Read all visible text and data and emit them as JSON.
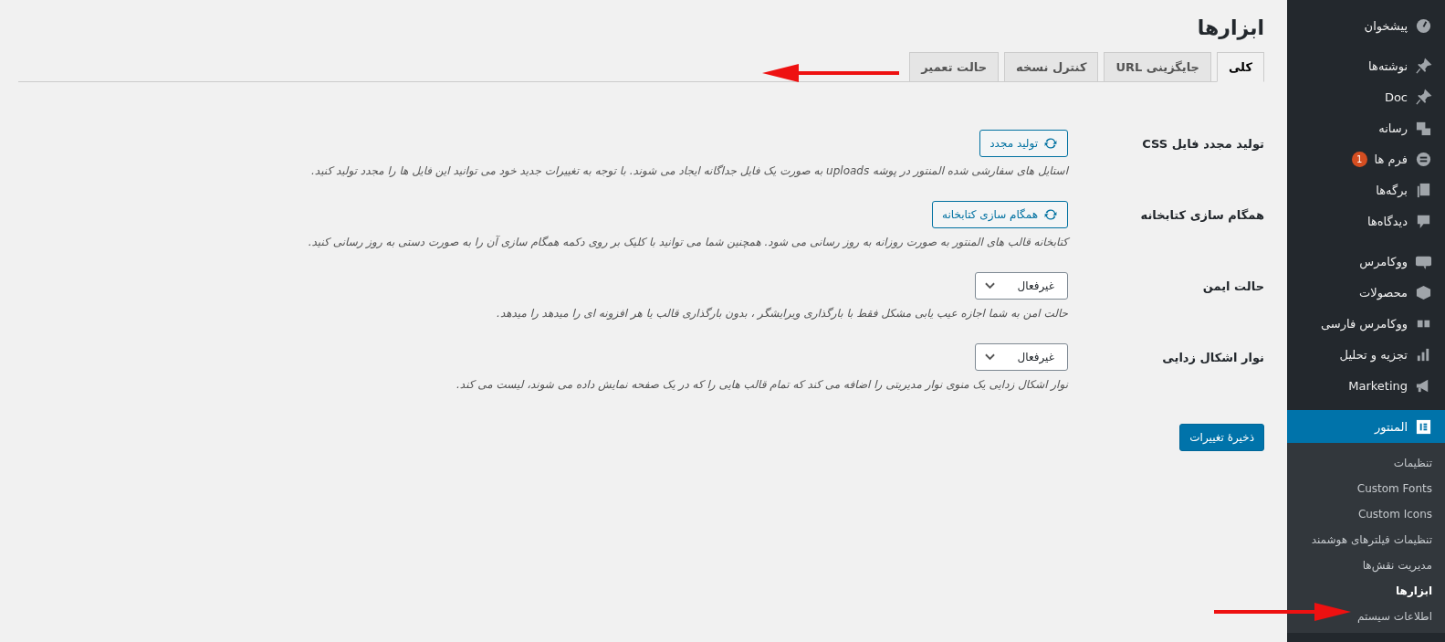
{
  "page_title": "ابزارها",
  "tabs": [
    {
      "label": "کلی",
      "selected": true
    },
    {
      "label": "جایگزینی URL",
      "selected": false
    },
    {
      "label": "کنترل نسخه",
      "selected": false
    },
    {
      "label": "حالت تعمیر",
      "selected": false
    }
  ],
  "settings": [
    {
      "kind": "button",
      "label": "تولید مجدد فایل CSS",
      "control": "تولید مجدد",
      "description": "استایل های سفارشی شده المنتور در پوشه uploads به صورت یک فایل جداگانه ایجاد می شوند. با توجه به تغییرات جدید خود می توانید این فایل ها را مجدد تولید کنید."
    },
    {
      "kind": "button",
      "label": "همگام سازی کتابخانه",
      "control": "همگام سازی کتابخانه",
      "description": "کتابخانه قالب های المنتور به صورت روزانه به روز رسانی می شود. همچنین شما می توانید با کلیک بر روی دکمه همگام سازی آن را به صورت دستی به روز رسانی کنید."
    },
    {
      "kind": "select",
      "label": "حالت ایمن",
      "control": "غیرفعال",
      "description": "حالت امن به شما اجازه عیب یابی مشکل فقط با بارگذاری ویرایشگر ، بدون بارگذاری قالب یا هر افزونه ای را میدهد را میدهد."
    },
    {
      "kind": "select",
      "label": "نوار اشکال زدایی",
      "control": "غیرفعال",
      "description": "نوار اشکال زدایی یک منوی نوار مدیریتی را اضافه می کند که تمام قالب هایی را که در یک صفحه نمایش داده می شوند، لیست می کند."
    }
  ],
  "save_button": "ذخیرهٔ تغییرات",
  "sidebar": {
    "groups": [
      {
        "items": [
          {
            "label": "پیشخوان",
            "selected": false
          }
        ]
      },
      {
        "items": [
          {
            "label": "نوشته‌ها",
            "selected": false
          },
          {
            "label": "Doc",
            "selected": false
          },
          {
            "label": "رسانه",
            "selected": false
          },
          {
            "label": "فرم ها",
            "badge": "1",
            "selected": false
          },
          {
            "label": "برگه‌ها",
            "selected": false
          },
          {
            "label": "دیدگاه‌ها",
            "selected": false
          }
        ]
      },
      {
        "items": [
          {
            "label": "ووکامرس",
            "selected": false
          },
          {
            "label": "محصولات",
            "selected": false
          },
          {
            "label": "ووکامرس فارسی",
            "selected": false
          },
          {
            "label": "تجزیه و تحلیل",
            "selected": false
          },
          {
            "label": "Marketing",
            "selected": false
          }
        ]
      },
      {
        "items": [
          {
            "label": "المنتور",
            "selected": true,
            "children": [
              {
                "label": "تنظیمات",
                "selected": false
              },
              {
                "label": "Custom Fonts",
                "selected": false
              },
              {
                "label": "Custom Icons",
                "selected": false
              },
              {
                "label": "تنظیمات فیلترهای هوشمند",
                "selected": false
              },
              {
                "label": "مدیریت نقش‌ها",
                "selected": false
              },
              {
                "label": "ابزارها",
                "selected": true
              },
              {
                "label": "اطلاعات سیستم",
                "selected": false
              }
            ]
          }
        ]
      }
    ]
  }
}
